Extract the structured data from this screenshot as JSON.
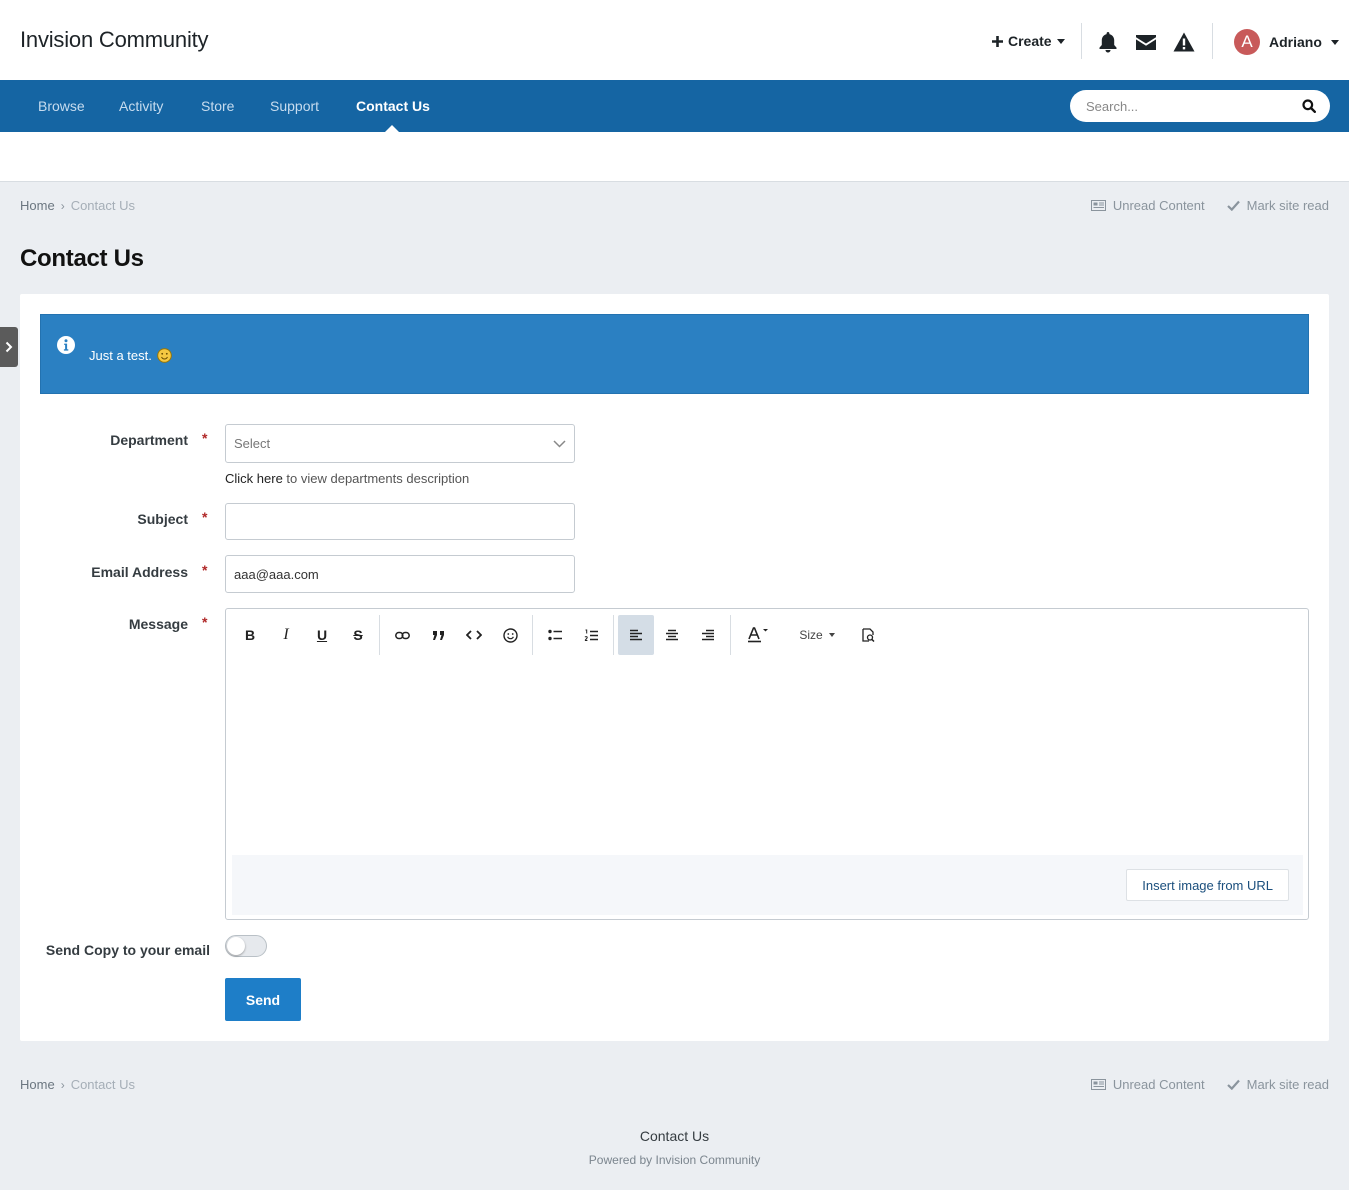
{
  "site": {
    "title": "Invision Community"
  },
  "header": {
    "create_label": "Create",
    "icons": [
      "bell-icon",
      "envelope-icon",
      "warning-icon"
    ],
    "user": {
      "initial": "A",
      "name": "Adriano",
      "avatar_color": "#c85a5a"
    }
  },
  "nav": {
    "items": [
      {
        "label": "Browse",
        "active": false
      },
      {
        "label": "Activity",
        "active": false
      },
      {
        "label": "Store",
        "active": false
      },
      {
        "label": "Support",
        "active": false
      },
      {
        "label": "Contact Us",
        "active": true
      }
    ],
    "search_placeholder": "Search..."
  },
  "breadcrumb": {
    "home": "Home",
    "current": "Contact Us",
    "actions": [
      "Unread Content",
      "Mark site read"
    ]
  },
  "page": {
    "title": "Contact Us"
  },
  "info_message": {
    "text": "Just a test."
  },
  "form": {
    "department": {
      "label": "Department",
      "required": "*",
      "placeholder": "Select",
      "help_link": "Click here",
      "help_text": " to view departments description"
    },
    "subject": {
      "label": "Subject",
      "required": "*",
      "value": ""
    },
    "email": {
      "label": "Email Address",
      "required": "*",
      "value": "aaa@aaa.com"
    },
    "message": {
      "label": "Message",
      "required": "*",
      "toolbar": {
        "bold": "B",
        "italic": "I",
        "underline": "U",
        "strike": "S",
        "size": "Size",
        "align_left_active": true
      },
      "insert_image_label": "Insert image from URL"
    },
    "send_copy": {
      "label": "Send Copy to your email",
      "checked": false
    },
    "submit_label": "Send"
  },
  "footer": {
    "link": "Contact Us",
    "powered": "Powered by Invision Community"
  },
  "colors": {
    "nav_bg": "#1565a3",
    "info_bg": "#2b80c2",
    "button_bg": "#1e7ec8",
    "required": "#b02828"
  }
}
